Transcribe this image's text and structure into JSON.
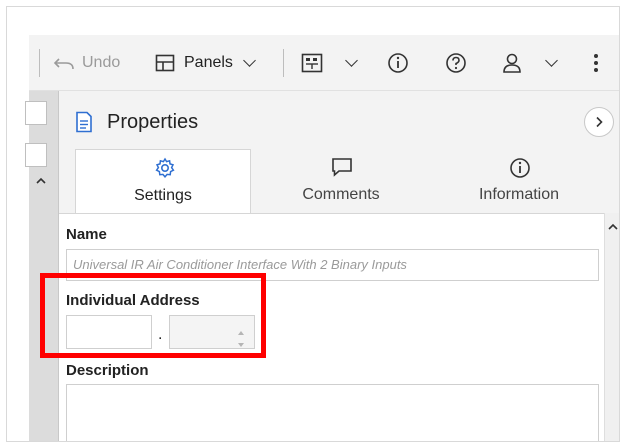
{
  "toolbar": {
    "undo_label": "Undo",
    "panels_label": "Panels"
  },
  "properties": {
    "title": "Properties",
    "tabs": [
      {
        "label": "Settings",
        "active": true,
        "icon": "gear-icon"
      },
      {
        "label": "Comments",
        "active": false,
        "icon": "comment-icon"
      },
      {
        "label": "Information",
        "active": false,
        "icon": "info-icon"
      }
    ],
    "name_label": "Name",
    "name_value": "Universal IR Air Conditioner Interface With 2 Binary Inputs",
    "individual_address_label": "Individual Address",
    "address_separator": ".",
    "description_label": "Description"
  },
  "colors": {
    "accent": "#2f6fd1",
    "highlight": "#ff0000"
  }
}
